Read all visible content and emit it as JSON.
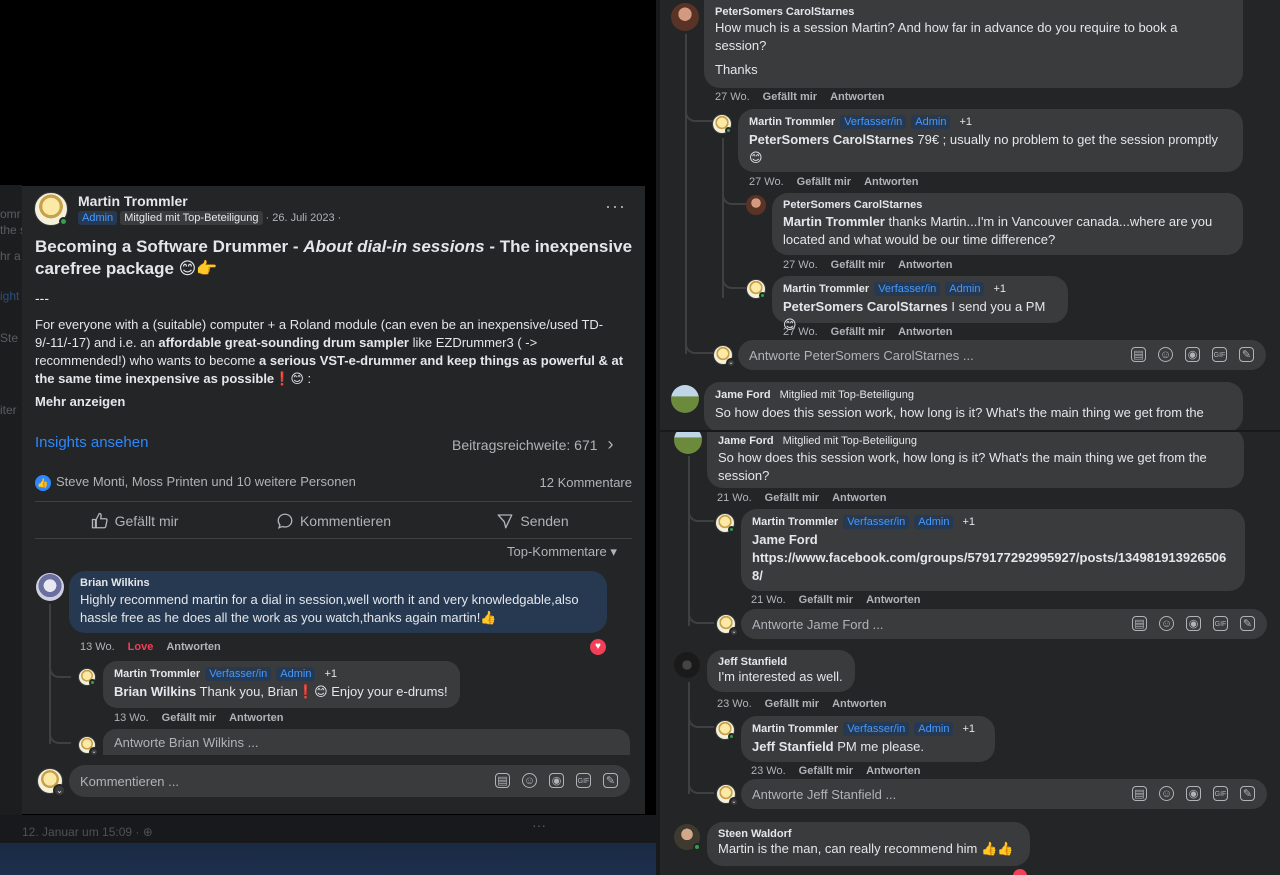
{
  "post": {
    "author": "Martin Trommler",
    "badge_admin": "Admin",
    "badge_top": "Mitglied mit Top-Beteiligung",
    "date": "· 26. Juli 2023 ·",
    "more": "···",
    "title_part1": "Becoming a Software Drummer - ",
    "title_italic": "About dial-in sessions",
    "title_part2": " - The inexpensive carefree package 😊👉",
    "separator": "---",
    "body_1": "For everyone with a (suitable) computer + a Roland module (can even be an inexpensive/used TD-9/-11/-17) and i.e. an ",
    "body_b1": "affordable great-sounding drum sampler",
    "body_2": " like EZDrummer3 ( -> recommended!) who wants to become ",
    "body_b2": "a serious VST-e-drummer and keep things as powerful & at the same time inexpensive as possible❗😊",
    "body_3": " :",
    "more_text": "Mehr anzeigen",
    "insights": "Insights ansehen",
    "reach": "Beitragsreichweite: 671",
    "reactions_names": "Steve Monti, Moss Printen und 10 weitere Personen",
    "comments_count": "12 Kommentare",
    "action_like": "Gefällt mir",
    "action_comment": "Kommentieren",
    "action_send": "Senden",
    "top_comments": "Top-Kommentare ▾",
    "comment_placeholder": "Kommentieren ..."
  },
  "left_comments": {
    "brian": {
      "name": "Brian Wilkins",
      "text": "Highly recommend martin for a dial in session,well worth it and very knowledgable,also hassle free as he does all the work as you watch,thanks again martin!👍",
      "time": "13 Wo.",
      "love": "Love",
      "reply": "Antworten"
    },
    "martin_reply": {
      "name": "Martin Trommler",
      "badge_author": "Verfasser/in",
      "badge_admin": "Admin",
      "badge_plus": "+1",
      "mention": "Brian Wilkins",
      "text": " Thank you, Brian❗😊 Enjoy your e-drums!",
      "time": "13 Wo.",
      "like": "Gefällt mir",
      "reply": "Antworten"
    },
    "reply_placeholder": "Antworte Brian Wilkins ..."
  },
  "left_ghost": {
    "bottom_text": "12. Januar um 15:09 · ⊕",
    "bottom_dots": "···",
    "side_snippets": [
      "omr",
      "the s",
      "hr a",
      "ight",
      "Ste",
      "iter"
    ]
  },
  "right_top": {
    "peter1": {
      "name": "PeterSomers CarolStarnes",
      "text1": "How much is a session Martin? And how far in advance do you require to book a session?",
      "text2": "Thanks",
      "time": "27 Wo.",
      "like": "Gefällt mir",
      "reply": "Antworten"
    },
    "martin1": {
      "name": "Martin Trommler",
      "badge_author": "Verfasser/in",
      "badge_admin": "Admin",
      "badge_plus": "+1",
      "mention": "PeterSomers CarolStarnes",
      "text": " 79€ ; usually no problem to get the session promptly 😊",
      "time": "27 Wo.",
      "like": "Gefällt mir",
      "reply": "Antworten"
    },
    "peter2": {
      "name": "PeterSomers CarolStarnes",
      "mention": "Martin Trommler",
      "text": " thanks Martin...I'm in Vancouver canada...where are you located and what would be our time difference?",
      "time": "27 Wo.",
      "like": "Gefällt mir",
      "reply": "Antworten"
    },
    "martin2": {
      "name": "Martin Trommler",
      "badge_author": "Verfasser/in",
      "badge_admin": "Admin",
      "badge_plus": "+1",
      "mention": "PeterSomers CarolStarnes",
      "text": " I send you a PM 😊",
      "time": "27 Wo.",
      "like": "Gefällt mir",
      "reply": "Antworten"
    },
    "reply_placeholder": "Antworte PeterSomers CarolStarnes ...",
    "jame_preview": {
      "name": "Jame Ford",
      "badge_top": "Mitglied mit Top-Beteiligung",
      "text": "So how does this session work, how long is it? What's the main thing we get from the"
    }
  },
  "right_bottom": {
    "jame": {
      "name": "Jame Ford",
      "badge_top": "Mitglied mit Top-Beteiligung",
      "text": "So how does this session work, how long is it? What's the main thing we get from the session?",
      "time": "21 Wo.",
      "like": "Gefällt mir",
      "reply": "Antworten"
    },
    "martin3": {
      "name": "Martin Trommler",
      "badge_author": "Verfasser/in",
      "badge_admin": "Admin",
      "badge_plus": "+1",
      "mention": "Jame Ford",
      "link": "https://www.facebook.com/groups/579177292995927/posts/1349819139265068/",
      "time": "21 Wo.",
      "like": "Gefällt mir",
      "reply": "Antworten"
    },
    "reply_jame": "Antworte Jame Ford ...",
    "jeff": {
      "name": "Jeff Stanfield",
      "text": "I'm interested as well.",
      "time": "23 Wo.",
      "like": "Gefällt mir",
      "reply": "Antworten"
    },
    "martin4": {
      "name": "Martin Trommler",
      "badge_author": "Verfasser/in",
      "badge_admin": "Admin",
      "badge_plus": "+1",
      "mention": "Jeff Stanfield",
      "text": " PM me please.",
      "time": "23 Wo.",
      "like": "Gefällt mir",
      "reply": "Antworten"
    },
    "reply_jeff": "Antworte Jeff Stanfield ...",
    "steen": {
      "name": "Steen Waldorf",
      "text": "Martin is the man, can really recommend him 👍👍"
    }
  },
  "colors": {
    "card_bg": "#242526",
    "bubble_bg": "#3a3b3c",
    "accent_blue": "#2d88ff",
    "love_red": "#f33e58",
    "online_green": "#31a24c"
  }
}
